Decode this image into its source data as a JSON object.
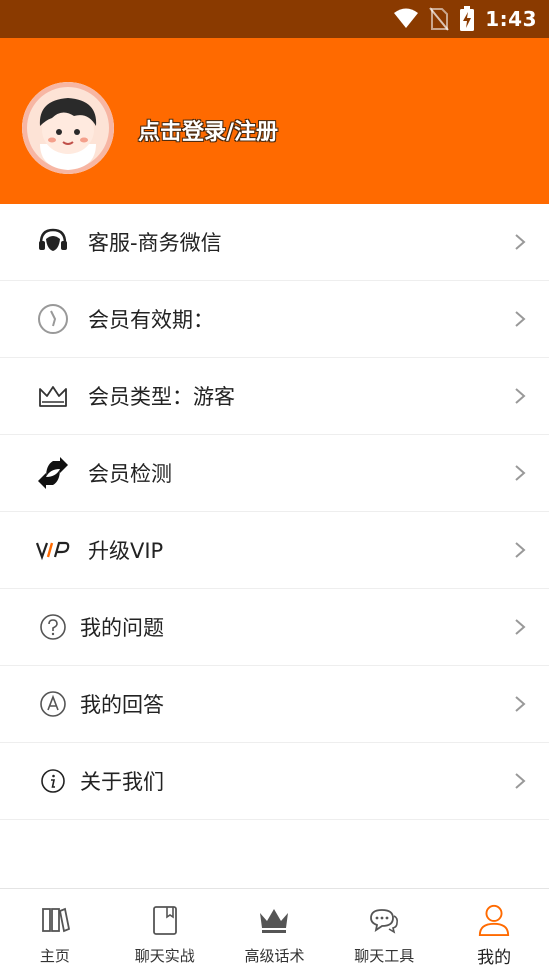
{
  "status_bar": {
    "time": "1:43"
  },
  "header": {
    "login_text": "点击登录/注册"
  },
  "menu": {
    "items": [
      {
        "label": "客服-商务微信",
        "icon": "headset-icon"
      },
      {
        "label": "会员有效期：",
        "icon": "clock-icon"
      },
      {
        "label": "会员类型：游客",
        "icon": "crown-icon"
      },
      {
        "label": "会员检测",
        "icon": "refresh-icon"
      },
      {
        "label": "升级VIP",
        "icon": "vip-icon"
      },
      {
        "label": "我的问题",
        "icon": "question-icon"
      },
      {
        "label": "我的回答",
        "icon": "answer-icon"
      },
      {
        "label": "关于我们",
        "icon": "info-icon"
      }
    ]
  },
  "tabbar": {
    "tabs": [
      {
        "label": "主页",
        "icon": "books-icon"
      },
      {
        "label": "聊天实战",
        "icon": "notebook-icon"
      },
      {
        "label": "高级话术",
        "icon": "crown-icon"
      },
      {
        "label": "聊天工具",
        "icon": "chat-bubbles-icon"
      },
      {
        "label": "我的",
        "icon": "user-icon"
      }
    ],
    "active_color": "#ff6a00"
  },
  "colors": {
    "header_bg": "#ff6a00",
    "status_bg": "#8a3a00",
    "accent": "#ff6a00"
  }
}
